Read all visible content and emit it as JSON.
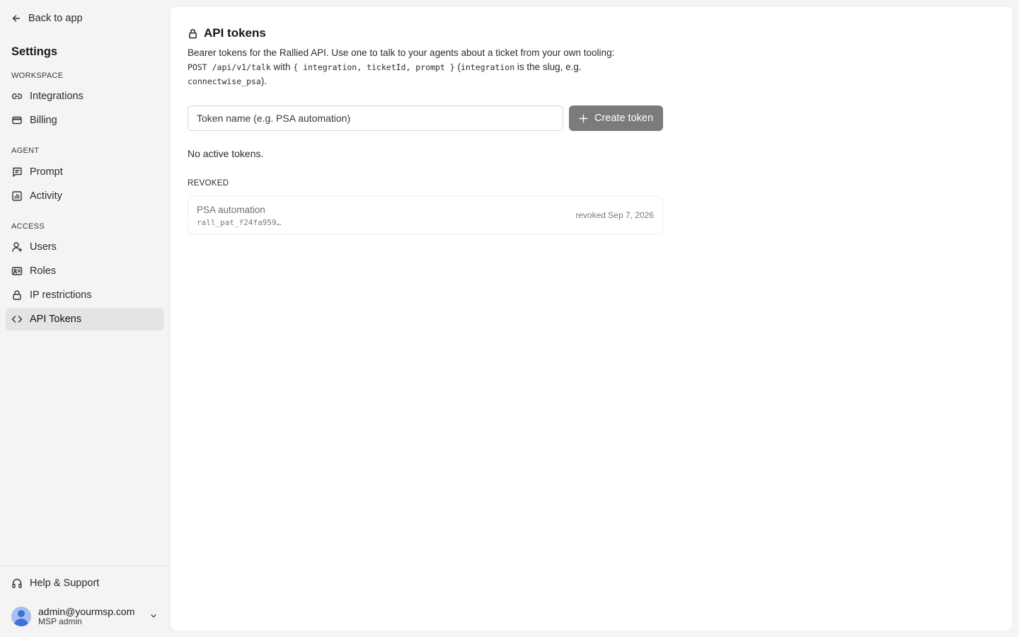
{
  "sidebar": {
    "back_label": "Back to app",
    "title": "Settings",
    "sections": {
      "workspace": {
        "label": "WORKSPACE",
        "items": [
          {
            "label": "Integrations",
            "icon": "link-icon"
          },
          {
            "label": "Billing",
            "icon": "credit-card-icon"
          }
        ]
      },
      "agent": {
        "label": "AGENT",
        "items": [
          {
            "label": "Prompt",
            "icon": "message-square-icon"
          },
          {
            "label": "Activity",
            "icon": "bar-chart-icon"
          }
        ]
      },
      "access": {
        "label": "ACCESS",
        "items": [
          {
            "label": "Users",
            "icon": "user-plus-icon"
          },
          {
            "label": "Roles",
            "icon": "id-card-icon"
          },
          {
            "label": "IP restrictions",
            "icon": "lock-icon"
          },
          {
            "label": "API Tokens",
            "icon": "code-icon",
            "active": true
          }
        ]
      }
    },
    "footer": {
      "help_label": "Help & Support",
      "user_email": "admin@yourmsp.com",
      "user_role": "MSP admin"
    }
  },
  "main": {
    "title": "API tokens",
    "description": {
      "line1": "Bearer tokens for the Rallied API. Use one to talk to your agents about a ticket from your own tooling:",
      "endpoint": "POST /api/v1/talk",
      "with_text": " with ",
      "params": "{ integration, ticketId, prompt }",
      "paren_open": " (",
      "integration_code": "integration",
      "slug_text": " is the slug, e.g.",
      "example_slug": "connectwise_psa",
      "closing": ")."
    },
    "input_placeholder": "Token name (e.g. PSA automation)",
    "create_button_label": "Create token",
    "empty_message": "No active tokens.",
    "revoked_section_label": "REVOKED",
    "revoked_tokens": [
      {
        "name": "PSA automation",
        "prefix": "rall_pat_f24fa959…",
        "revoked_text": "revoked Sep 7, 2026"
      }
    ]
  },
  "colors": {
    "sidebar_bg": "#f4f4f4",
    "active_item_bg": "#e4e4e4",
    "create_button_bg": "#7b7b7b",
    "avatar_bg": "#a9bff2",
    "avatar_fg": "#3f6fd9"
  }
}
